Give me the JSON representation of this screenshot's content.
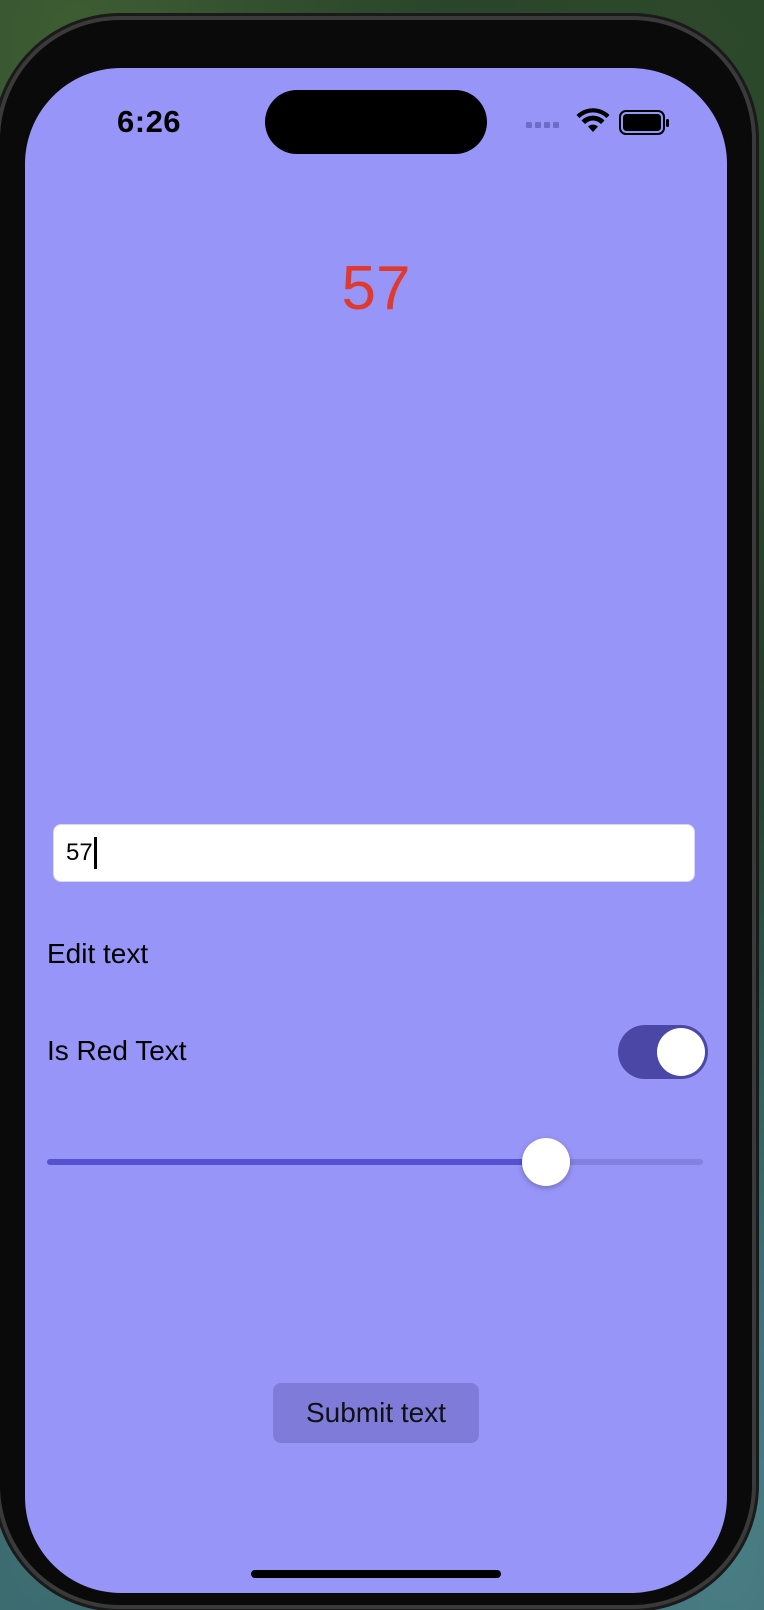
{
  "status_bar": {
    "time": "6:26"
  },
  "display": {
    "number": "57",
    "color": "#e03a2f"
  },
  "text_field": {
    "value": "57"
  },
  "edit_label": "Edit text",
  "toggle_row": {
    "label": "Is Red Text",
    "on": true
  },
  "slider": {
    "value_fraction": 0.76
  },
  "submit_button": {
    "label": "Submit text"
  },
  "colors": {
    "background": "#9795f7",
    "accent": "#5452d0",
    "toggle_on": "#4b47a6"
  }
}
